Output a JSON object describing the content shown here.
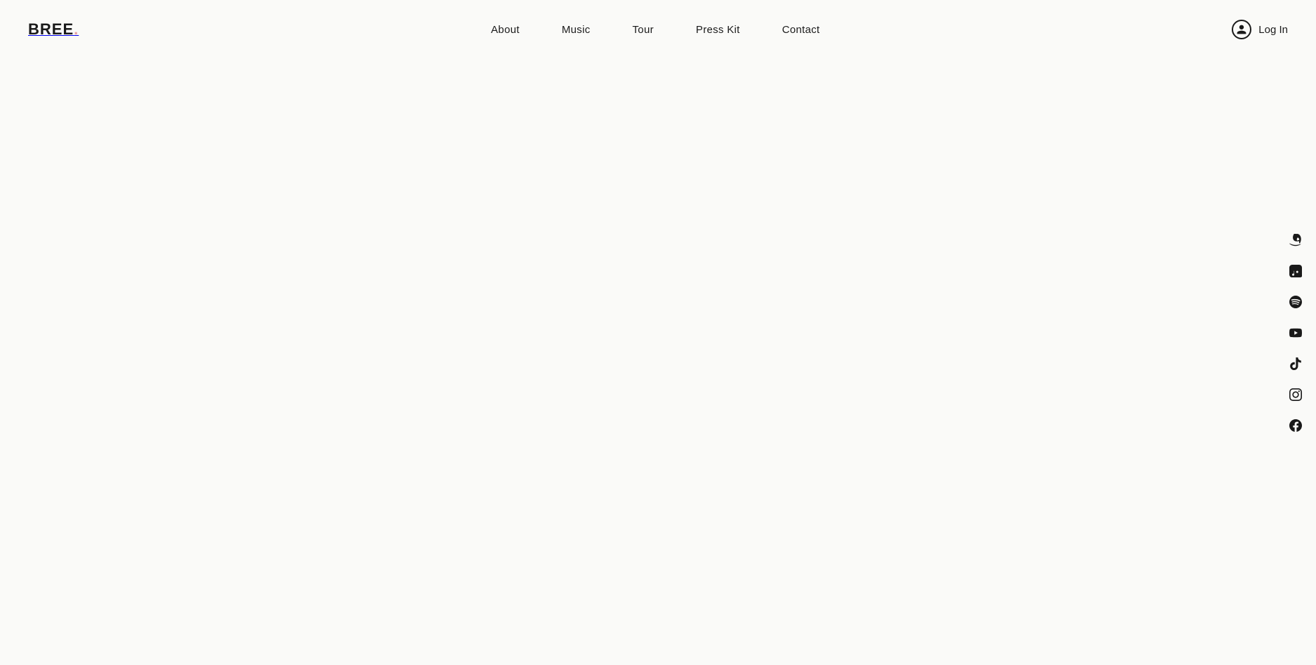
{
  "logo": {
    "text": "BREE",
    "dot": "."
  },
  "nav": {
    "items": [
      {
        "label": "About",
        "id": "about"
      },
      {
        "label": "Music",
        "id": "music"
      },
      {
        "label": "Tour",
        "id": "tour"
      },
      {
        "label": "Press Kit",
        "id": "press-kit"
      },
      {
        "label": "Contact",
        "id": "contact"
      }
    ],
    "login": {
      "label": "Log In"
    }
  },
  "social": {
    "items": [
      {
        "id": "amazon",
        "label": "Amazon Music"
      },
      {
        "id": "apple-music",
        "label": "Apple Music"
      },
      {
        "id": "spotify",
        "label": "Spotify"
      },
      {
        "id": "youtube",
        "label": "YouTube"
      },
      {
        "id": "tiktok",
        "label": "TikTok"
      },
      {
        "id": "instagram",
        "label": "Instagram"
      },
      {
        "id": "facebook",
        "label": "Facebook"
      }
    ]
  }
}
